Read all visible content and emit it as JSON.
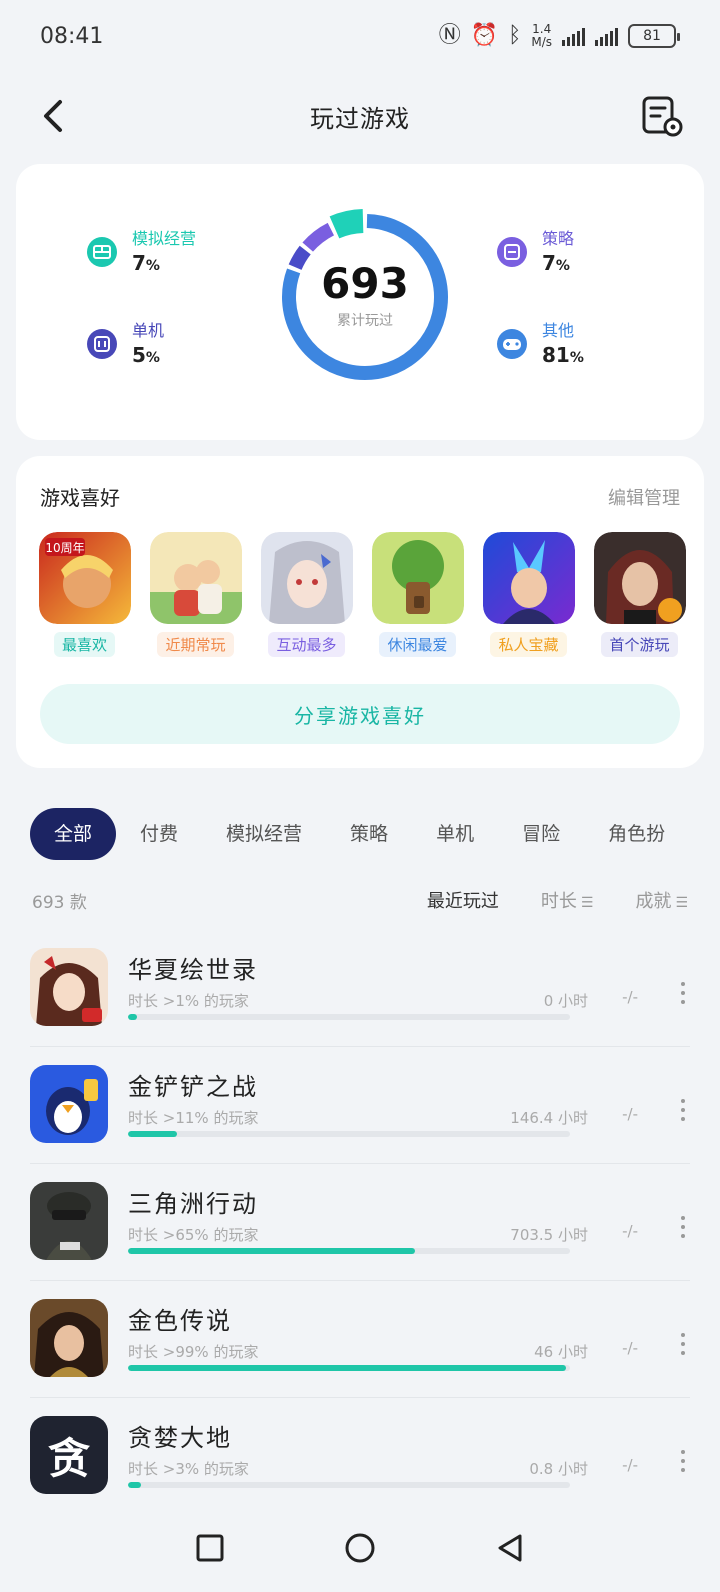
{
  "status": {
    "time": "08:41",
    "net_speed_value": "1.4",
    "net_speed_unit": "M/s",
    "battery": "81"
  },
  "header": {
    "title": "玩过游戏",
    "back_icon": "chevron-left-icon",
    "settings_icon": "list-settings-icon"
  },
  "stats": {
    "total": "693",
    "total_label": "累计玩过",
    "categories": [
      {
        "name": "模拟经营",
        "percent": "7",
        "unit": "%",
        "color": "#1bc8b0",
        "icon": "brick-icon"
      },
      {
        "name": "策略",
        "percent": "7",
        "unit": "%",
        "color": "#6b5bd6",
        "icon": "strategy-icon"
      },
      {
        "name": "单机",
        "percent": "5",
        "unit": "%",
        "color": "#4848b8",
        "icon": "controller-box-icon"
      },
      {
        "name": "其他",
        "percent": "81",
        "unit": "%",
        "color": "#3d86e0",
        "icon": "gamepad-icon"
      }
    ],
    "donut_segments": [
      {
        "label": "其他",
        "percent": 81,
        "color": "#3d86e0"
      },
      {
        "label": "单机",
        "percent": 5,
        "color": "#4a4cc8"
      },
      {
        "label": "策略",
        "percent": 7,
        "color": "#7a5fe0"
      },
      {
        "label": "模拟经营",
        "percent": 7,
        "color": "#1fd1b8"
      }
    ]
  },
  "preferences": {
    "title": "游戏喜好",
    "manage_label": "编辑管理",
    "items": [
      {
        "tag": "最喜欢",
        "tag_color": "#19b6a4",
        "tag_bg": "#e6f8f6",
        "badge": "10周年"
      },
      {
        "tag": "近期常玩",
        "tag_color": "#f08a4b",
        "tag_bg": "#fdf0e6"
      },
      {
        "tag": "互动最多",
        "tag_color": "#7a5fe0",
        "tag_bg": "#efebfc"
      },
      {
        "tag": "休闲最爱",
        "tag_color": "#3d86e0",
        "tag_bg": "#e8f1fc"
      },
      {
        "tag": "私人宝藏",
        "tag_color": "#f0a020",
        "tag_bg": "#fdf5e4"
      },
      {
        "tag": "首个游玩",
        "tag_color": "#4848b8",
        "tag_bg": "#ececf8"
      }
    ],
    "share_label": "分享游戏喜好"
  },
  "filters": {
    "tabs": [
      "全部",
      "付费",
      "模拟经营",
      "策略",
      "单机",
      "冒险",
      "角色扮"
    ],
    "active_index": 0
  },
  "sort": {
    "count_label": "693 款",
    "options": [
      {
        "label": "最近玩过",
        "active": true
      },
      {
        "label": "时长",
        "icon": "☰",
        "active": false
      },
      {
        "label": "成就",
        "icon": "☰",
        "active": false
      }
    ]
  },
  "games": [
    {
      "name": "华夏绘世录",
      "rank": "时长 >1% 的玩家",
      "hours": "0 小时",
      "achievement": "-/-",
      "progress": 0.01
    },
    {
      "name": "金铲铲之战",
      "rank": "时长 >11% 的玩家",
      "hours": "146.4 小时",
      "achievement": "-/-",
      "progress": 0.11
    },
    {
      "name": "三角洲行动",
      "rank": "时长 >65% 的玩家",
      "hours": "703.5 小时",
      "achievement": "-/-",
      "progress": 0.65
    },
    {
      "name": "金色传说",
      "rank": "时长 >99% 的玩家",
      "hours": "46 小时",
      "achievement": "-/-",
      "progress": 0.99
    },
    {
      "name": "贪婪大地",
      "rank": "时长 >3% 的玩家",
      "hours": "0.8 小时",
      "achievement": "-/-",
      "progress": 0.03,
      "icon_text": "贪"
    }
  ],
  "navbar": {
    "icons": [
      "recent-apps-icon",
      "home-icon",
      "back-icon"
    ]
  }
}
